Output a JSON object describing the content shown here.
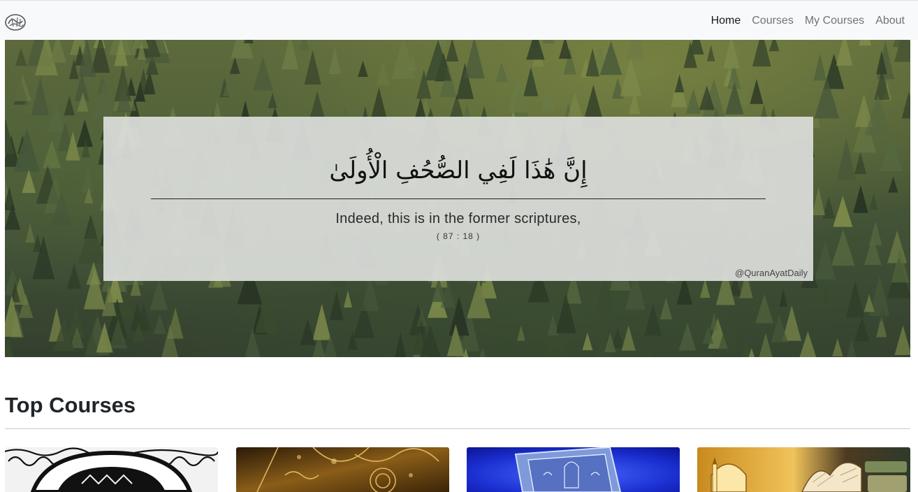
{
  "nav": {
    "brand_icon": "quran-calligraphy-logo-icon",
    "links": [
      {
        "label": "Home",
        "active": true
      },
      {
        "label": "Courses",
        "active": false
      },
      {
        "label": "My Courses",
        "active": false
      },
      {
        "label": "About",
        "active": false
      }
    ]
  },
  "hero": {
    "arabic": "إِنَّ هَٰذَا لَفِي الصُّحُفِ الْأُولَىٰ",
    "translation": "Indeed, this is in the former scriptures,",
    "reference": "( 87 : 18 )",
    "handle": "@QuranAyatDaily"
  },
  "section": {
    "title": "Top Courses"
  },
  "courses": [
    {
      "image": "ornamental-arch-image"
    },
    {
      "image": "golden-quran-cover-image"
    },
    {
      "image": "blue-quran-image"
    },
    {
      "image": "mosque-book-image"
    }
  ]
}
